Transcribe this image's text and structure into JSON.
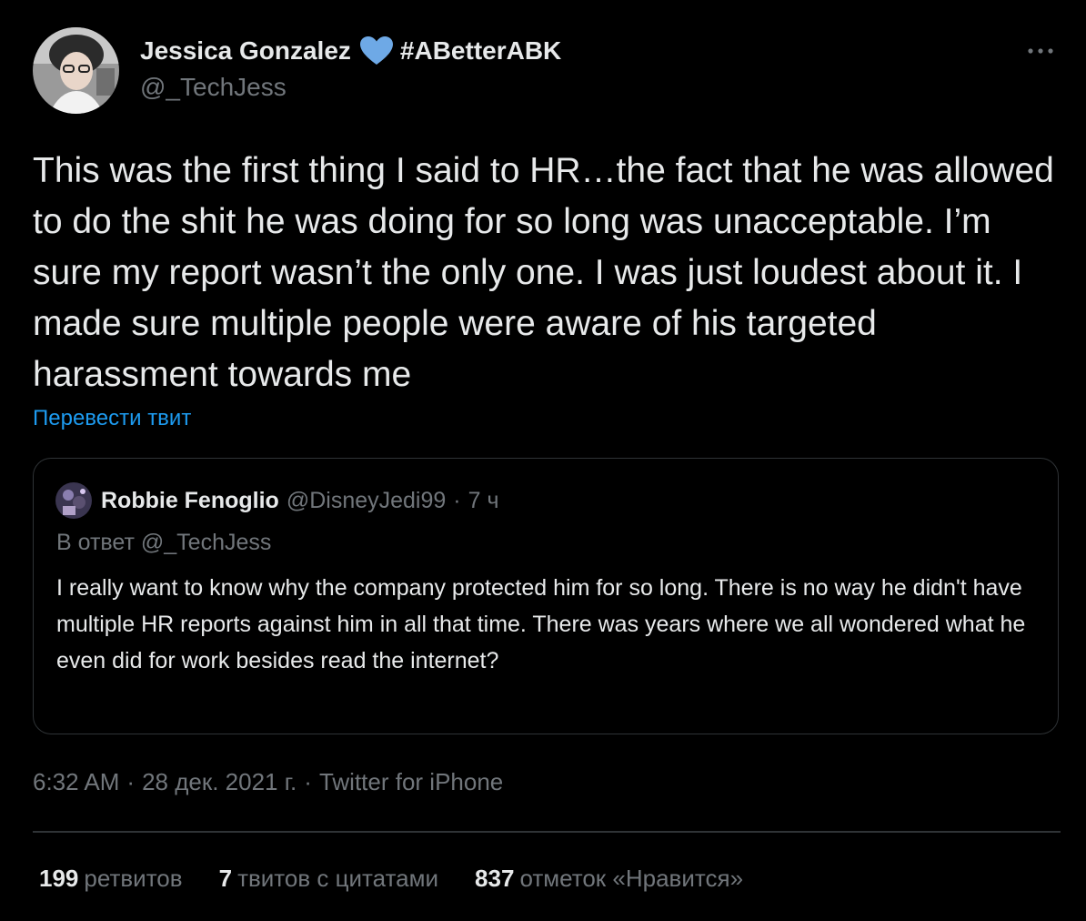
{
  "tweet": {
    "author": {
      "name": "Jessica Gonzalez",
      "badge_icon": "blue-heart-icon",
      "hashtag": "#ABetterABK",
      "handle": "@_TechJess"
    },
    "more_icon": "more-horizontal-icon",
    "text": "This was the first thing I said to HR…the fact that he was allowed to do the shit he was doing for so long was unacceptable. I’m sure my report wasn’t the only one. I was just loudest about it. I made sure multiple people were aware of his targeted harassment towards me",
    "translate_label": "Перевести твит",
    "quote": {
      "name": "Robbie Fenoglio",
      "handle": "@DisneyJedi99",
      "separator": "·",
      "time": "7 ч",
      "reply_to": "В ответ @_TechJess",
      "text": "I really want to know why the company protected him for so long. There is no way he didn't have multiple HR reports against him in all that time. There was years where we all wondered what he even did for work besides read the internet?"
    },
    "meta": {
      "time": "6:32 AM",
      "separator": "·",
      "date": "28 дек. 2021 г.",
      "source": "Twitter for iPhone"
    },
    "stats": {
      "retweets_count": "199",
      "retweets_label": "ретвитов",
      "quotes_count": "7",
      "quotes_label": "твитов с цитатами",
      "likes_count": "837",
      "likes_label": "отметок «Нравится»"
    },
    "colors": {
      "background": "#000000",
      "text": "#e7e9ea",
      "secondary": "#71767b",
      "link": "#1d9bf0",
      "border": "#2f3336",
      "heart": "#6ea9e6"
    }
  }
}
